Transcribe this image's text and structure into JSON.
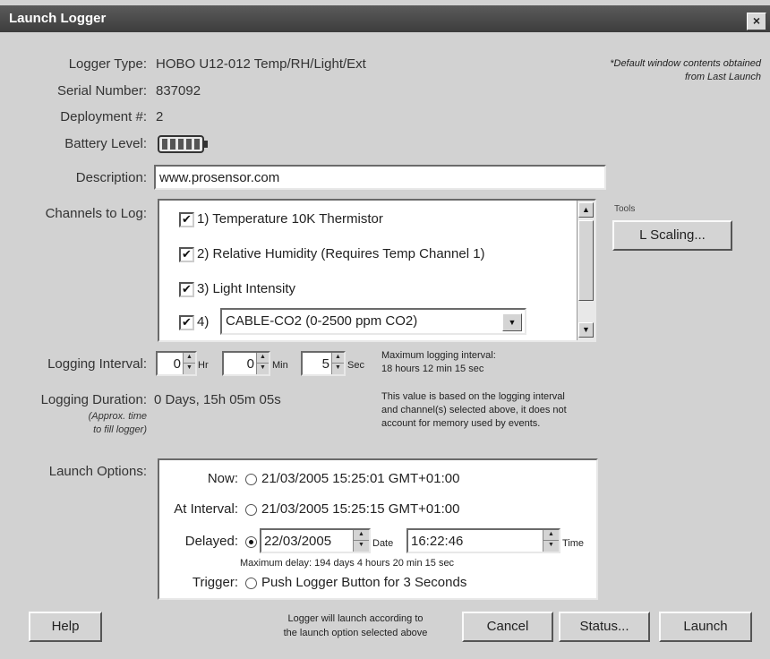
{
  "window": {
    "title": "Launch Logger",
    "close_label": "×"
  },
  "note_default": "*Default window contents obtained from Last Launch",
  "info": {
    "logger_type_label": "Logger Type:",
    "logger_type_value": "HOBO U12-012 Temp/RH/Light/Ext",
    "serial_label": "Serial Number:",
    "serial_value": "837092",
    "deployment_label": "Deployment #:",
    "deployment_value": "2",
    "battery_label": "Battery Level:",
    "battery_level": 1.0
  },
  "description": {
    "label": "Description:",
    "value": "www.prosensor.com"
  },
  "channels": {
    "label": "Channels to Log:",
    "items": [
      {
        "text": "1) Temperature 10K Thermistor",
        "checked": "✔"
      },
      {
        "text": "2) Relative Humidity (Requires Temp Channel 1)",
        "checked": "✔"
      },
      {
        "text": "3) Light Intensity",
        "checked": "✔"
      },
      {
        "text": "4)",
        "checked": "✔"
      }
    ],
    "channel4_select": "CABLE-CO2 (0-2500 ppm CO2)"
  },
  "tools": {
    "label": "Tools",
    "scaling_button": "L Scaling..."
  },
  "logging_interval": {
    "label": "Logging Interval:",
    "hr_value": "0",
    "hr_unit": "Hr",
    "min_value": "0",
    "min_unit": "Min",
    "sec_value": "5",
    "sec_unit": "Sec",
    "max_note_line1": "Maximum logging interval:",
    "max_note_line2": "18 hours 12 min 15 sec"
  },
  "logging_duration": {
    "label": "Logging Duration:",
    "value": "0 Days, 15h 05m 05s",
    "sub_line1": "(Approx. time",
    "sub_line2": "to fill logger)",
    "note_line1": "This value is based on the logging interval",
    "note_line2": "and channel(s) selected above, it does not",
    "note_line3": "account for memory used by events."
  },
  "launch_options": {
    "label": "Launch Options:",
    "now_label": "Now:",
    "now_value": "21/03/2005 15:25:01 GMT+01:00",
    "interval_label": "At Interval:",
    "interval_value": "21/03/2005 15:25:15 GMT+01:00",
    "delayed_label": "Delayed:",
    "delayed_date": "22/03/2005",
    "date_unit": "Date",
    "delayed_time": "16:22:46",
    "time_unit": "Time",
    "max_delay": "Maximum delay: 194 days 4 hours 20 min 15 sec",
    "trigger_label": "Trigger:",
    "trigger_value": "Push Logger Button for 3 Seconds"
  },
  "footer": {
    "help": "Help",
    "note_line1": "Logger will launch according to",
    "note_line2": "the launch option selected above",
    "cancel": "Cancel",
    "status": "Status...",
    "launch": "Launch"
  }
}
